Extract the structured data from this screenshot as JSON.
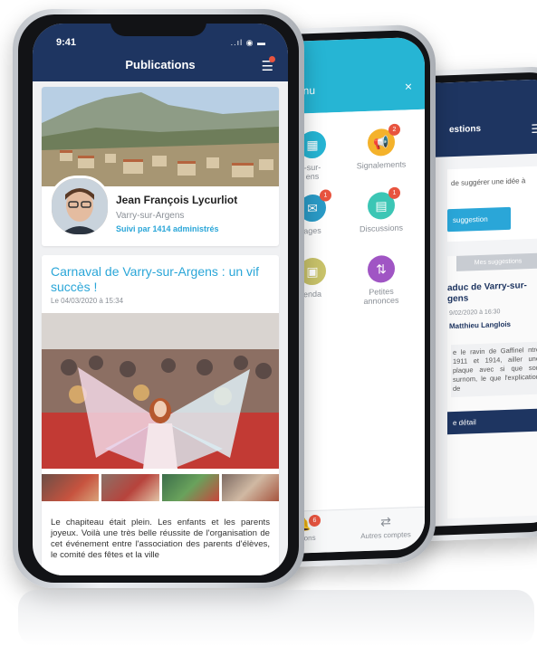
{
  "front": {
    "status": {
      "time": "9:41",
      "icons": "..ıl ◉ ▬"
    },
    "header": {
      "title": "Publications"
    },
    "profile": {
      "name": "Jean François Lycurliot",
      "town": "Varry-sur-Argens",
      "followers": "Suivi par 1414 administrés"
    },
    "post": {
      "title": "Carnaval de Varry-sur-Argens : un vif succès !",
      "date": "Le 04/03/2020 à 15:34",
      "text": "Le chapiteau était plein. Les enfants et les parents joyeux. Voilà une très belle réussite de l'organisation de cet événement entre l'association des parents d'élèves, le comité des fêtes et la ville"
    }
  },
  "middle": {
    "header": {
      "title": "enu",
      "close": "×"
    },
    "tiles": [
      {
        "label": "-sur-\nens",
        "icon": "building-icon",
        "color": "#26b5d4",
        "badge": ""
      },
      {
        "label": "Signalements",
        "icon": "megaphone-icon",
        "color": "#f4b22b",
        "badge": "2"
      },
      {
        "label": "ages",
        "icon": "message-icon",
        "color": "#2a9bc7",
        "badge": "1"
      },
      {
        "label": "Discussions",
        "icon": "chat-icon",
        "color": "#3cc6b5",
        "badge": "1"
      },
      {
        "label": "enda",
        "icon": "calendar-icon",
        "color": "#c9c36a",
        "badge": ""
      },
      {
        "label": "Petites\nannonces",
        "icon": "swap-icon",
        "color": "#a055c4",
        "badge": ""
      }
    ],
    "footer": {
      "left_label": "ications",
      "left_badge": "6",
      "right_label": "Autres comptes"
    }
  },
  "back": {
    "header": {
      "title": "estions"
    },
    "intro": "de suggérer une idée à",
    "button": "suggestion",
    "tab": "Mes suggestions",
    "item_title": "aduc de Varry-sur-\ngens",
    "item_date": "9/02/2020 à 16:30",
    "item_author": "Matthieu Langlois",
    "item_text": "e le ravin de Gaffinel ntre 1911 et 1914, ailler une plaque avec si que son surnom, le que l'explication de",
    "detail_button": "e détail"
  },
  "colors": {
    "navy": "#1e3561",
    "cyan": "#26b5d4",
    "link": "#2aa6d8",
    "badge": "#e8543f"
  }
}
